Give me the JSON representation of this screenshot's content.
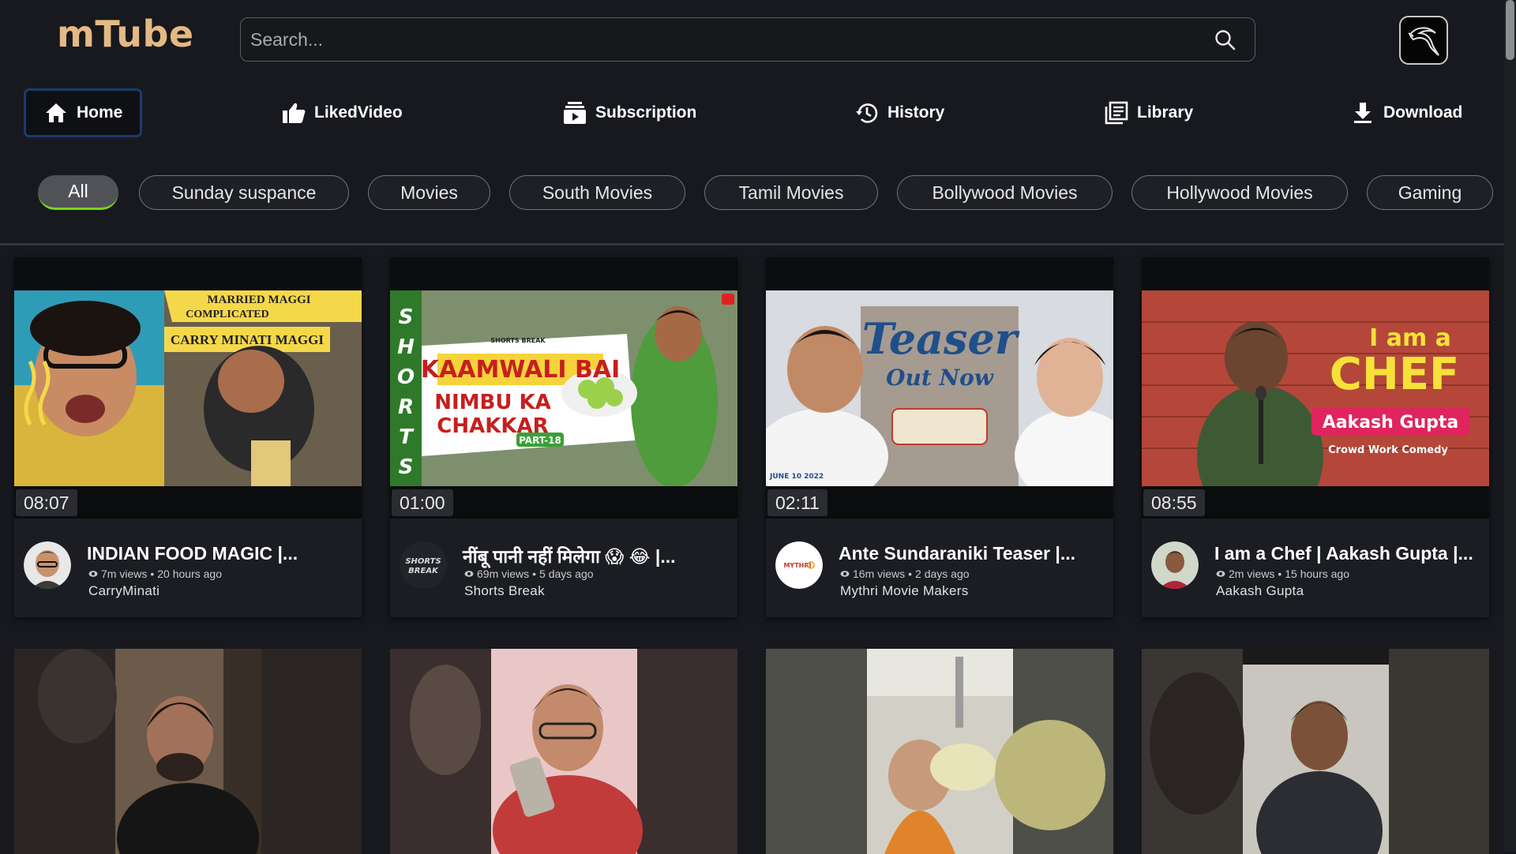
{
  "app": {
    "logo": "mTube"
  },
  "search": {
    "placeholder": "Search..."
  },
  "nav": [
    {
      "label": "Home",
      "icon": "home-icon"
    },
    {
      "label": "LikedVideo",
      "icon": "thumbs-up-icon"
    },
    {
      "label": "Subscription",
      "icon": "subscription-icon"
    },
    {
      "label": "History",
      "icon": "history-icon"
    },
    {
      "label": "Library",
      "icon": "library-icon"
    },
    {
      "label": "Download",
      "icon": "download-icon"
    }
  ],
  "chips": [
    "All",
    "Sunday suspance",
    "Movies",
    "South Movies",
    "Tamil Movies",
    "Bollywood Movies",
    "Hollywood Movies",
    "Gaming"
  ],
  "videos": [
    {
      "duration": "08:07",
      "title": "INDIAN FOOD MAGIC |...",
      "views": "7m views",
      "age": "20 hours ago",
      "channel": "CarryMinati",
      "thumb_text": [
        "MARRIED MAGGI",
        "COMPLICATED",
        "CARRY MINATI MAGGI"
      ]
    },
    {
      "duration": "01:00",
      "title": "नींबू पानी नहीं मिलेगा 😱 😂 |...",
      "views": "69m views",
      "age": "5 days ago",
      "channel": "Shorts Break",
      "thumb_text": [
        "SHORTS",
        "SHORTS BREAK",
        "KAAMWALI BAI",
        "NIMBU KA",
        "CHAKKAR",
        "PART-18"
      ],
      "avatar_text": "SHORTS BREAK"
    },
    {
      "duration": "02:11",
      "title": "Ante Sundaraniki Teaser |...",
      "views": "16m views",
      "age": "2 days ago",
      "channel": "Mythri Movie Makers",
      "thumb_text": [
        "Teaser",
        "Out Now",
        "JUNE 10 2022"
      ],
      "avatar_text": "MYTHRI"
    },
    {
      "duration": "08:55",
      "title": "I am a Chef | Aakash Gupta |...",
      "views": "2m views",
      "age": "15 hours ago",
      "channel": "Aakash Gupta",
      "thumb_text": [
        "I am a",
        "CHEF",
        "Aakash Gupta",
        "Crowd Work Comedy"
      ]
    }
  ],
  "colors": {
    "background": "#17191e",
    "logo": "#e4b983",
    "active_chip_underline": "#7ed321",
    "active_nav_border": "#1c3a6e"
  }
}
